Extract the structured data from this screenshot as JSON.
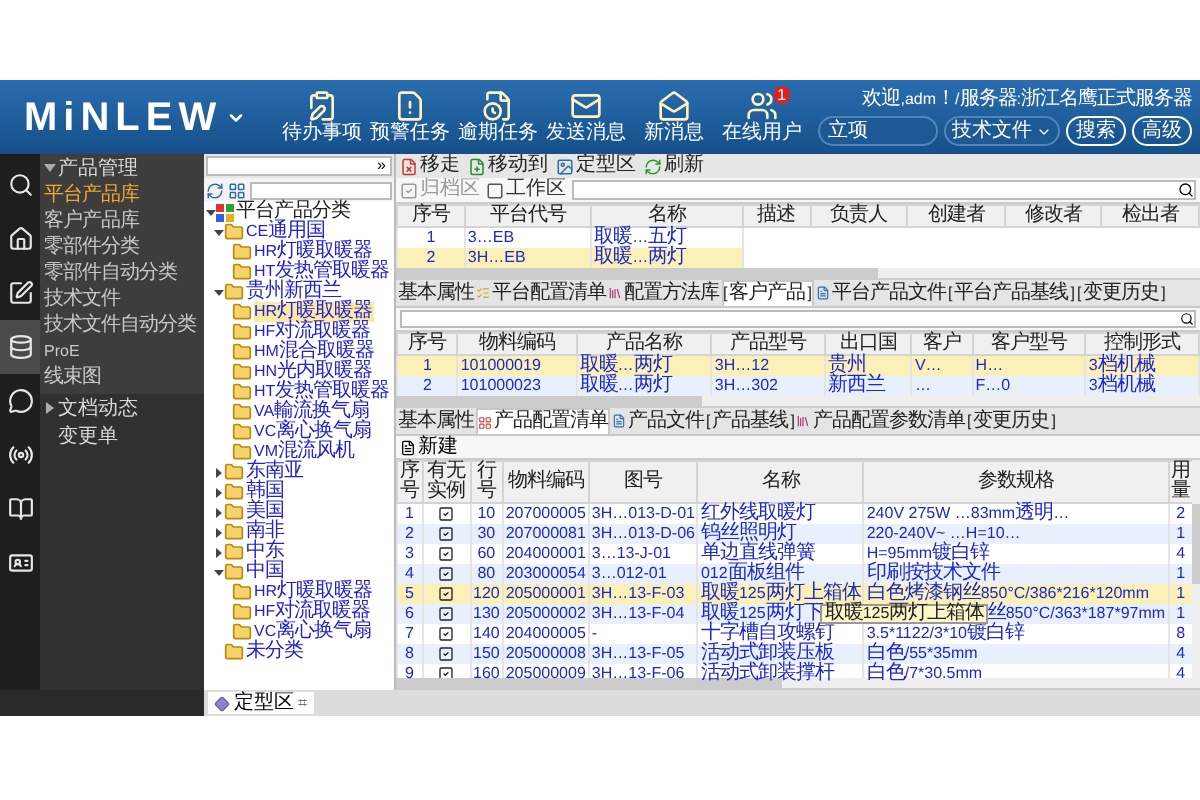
{
  "header": {
    "logo": "MiNLEW",
    "welcome": "欢迎,adm！/服务器:浙江名鹰正式服务器",
    "nav": [
      {
        "label": "待办事项"
      },
      {
        "label": "预警任务"
      },
      {
        "label": "逾期任务"
      },
      {
        "label": "发送消息"
      },
      {
        "label": "新消息"
      },
      {
        "label": "在线用户",
        "badge": "1"
      }
    ],
    "search": {
      "value": "立项"
    },
    "scope": {
      "value": "技术文件"
    },
    "buttons": [
      "搜索",
      "高级"
    ]
  },
  "sidebar": {
    "icons": [
      {
        "kind": "search",
        "selected": false
      },
      {
        "kind": "home",
        "selected": false
      },
      {
        "kind": "edit",
        "selected": false
      },
      {
        "kind": "database",
        "selected": true
      },
      {
        "kind": "chat",
        "selected": false
      },
      {
        "kind": "broadcast",
        "selected": false
      },
      {
        "kind": "book",
        "selected": false
      },
      {
        "kind": "card",
        "selected": false
      }
    ],
    "menu": [
      {
        "kind": "group",
        "label": "产品管理",
        "expanded": true,
        "children": [
          {
            "label": "平台产品库",
            "selected": true
          },
          {
            "label": "客户产品库",
            "selected": false
          },
          {
            "label": "零部件分类",
            "selected": false
          },
          {
            "label": "零部件自动分类",
            "selected": false
          },
          {
            "label": "技术文件",
            "selected": false
          },
          {
            "label": "技术文件自动分类",
            "selected": false
          },
          {
            "label": "ProE",
            "selected": false
          },
          {
            "label": "线束图",
            "selected": false
          }
        ]
      },
      {
        "kind": "group",
        "label": "文档动态",
        "expanded": false
      },
      {
        "kind": "item",
        "label": "变更单"
      }
    ]
  },
  "tree": {
    "dropdown": "»",
    "nodes": [
      {
        "kind": "root",
        "label": "平台产品分类",
        "expanded": true,
        "selected": false,
        "children": [
          {
            "label": "CE通用国",
            "expanded": true,
            "selected": false,
            "children": [
              {
                "label": "HR灯暖取暖器",
                "selected": false
              },
              {
                "label": "HT发热管取暖器",
                "selected": false
              }
            ]
          },
          {
            "label": "贵州新西兰",
            "expanded": true,
            "selected": false,
            "children": [
              {
                "label": "HR灯暖取暖器",
                "selected": true
              },
              {
                "label": "HF对流取暖器",
                "selected": false
              },
              {
                "label": "HM混合取暖器",
                "selected": false
              },
              {
                "label": "HN光内取暖器",
                "selected": false
              },
              {
                "label": "HT发热管取暖器",
                "selected": false
              },
              {
                "label": "VA輸流换气扇",
                "selected": false
              },
              {
                "label": "VC离心换气扇",
                "selected": false
              },
              {
                "label": "VM混流风机",
                "selected": false
              }
            ]
          },
          {
            "label": "东南亚",
            "expanded": false,
            "selected": false
          },
          {
            "label": "韩国",
            "expanded": false,
            "selected": false
          },
          {
            "label": "美国",
            "expanded": false,
            "selected": false
          },
          {
            "label": "南非",
            "expanded": false,
            "selected": false
          },
          {
            "label": "中东",
            "expanded": false,
            "selected": false
          },
          {
            "label": "中国",
            "expanded": true,
            "selected": false,
            "children": [
              {
                "label": "HR灯暖取暖器",
                "selected": false
              },
              {
                "label": "HF对流取暖器",
                "selected": false
              },
              {
                "label": "VC离心换气扇",
                "selected": false
              }
            ]
          },
          {
            "label": "未分类",
            "selected": false
          }
        ]
      }
    ]
  },
  "toolbar": [
    {
      "label": "移走"
    },
    {
      "label": "移动到"
    },
    {
      "label": "定型区"
    },
    {
      "label": "刷新"
    }
  ],
  "filter": {
    "checkboxes": [
      {
        "label": "归档区",
        "checked": true,
        "disabled": true
      },
      {
        "label": "工作区",
        "checked": false,
        "disabled": false
      }
    ]
  },
  "platform_table": {
    "columns": [
      "序号",
      "平台代号",
      "名称",
      "描述",
      "负责人",
      "创建者",
      "修改者",
      "检出者"
    ],
    "rows": [
      {
        "selected": false,
        "cells": [
          "1",
          "3…EB",
          "取暖…五灯"
        ]
      },
      {
        "selected": true,
        "cells": [
          "2",
          "3H…EB",
          "取暖…两灯"
        ]
      }
    ]
  },
  "upper_tabs": [
    {
      "label": "基本属性",
      "selected": false
    },
    {
      "label": "平台配置清单",
      "selected": false
    },
    {
      "label": "配置方法库",
      "selected": false
    },
    {
      "label": "[客户产品]",
      "selected": true
    },
    {
      "label": "平台产品文件",
      "selected": false
    },
    {
      "label": "[平台产品基线]",
      "selected": false
    },
    {
      "label": "[变更历史]",
      "selected": false
    }
  ],
  "customer_table": {
    "columns": [
      "序号",
      "物料编码",
      "产品名称",
      "产品型号",
      "出口国",
      "客户",
      "客户型号",
      "控制形式"
    ],
    "rows": [
      {
        "selected": true,
        "cells": [
          "1",
          "101000019",
          "取暖…两灯",
          "3H…12",
          "贵州",
          "V…",
          "H…",
          "3档机械"
        ]
      },
      {
        "selected": false,
        "cells": [
          "2",
          "101000023",
          "取暖…两灯",
          "3H…302",
          "新西兰",
          "…",
          "F…0",
          "3档机械"
        ]
      }
    ]
  },
  "lower_tabs": [
    {
      "label": "基本属性",
      "selected": false
    },
    {
      "label": "产品配置清单",
      "selected": true
    },
    {
      "label": "产品文件",
      "selected": false
    },
    {
      "label": "[产品基线]",
      "selected": false
    },
    {
      "label": "产品配置参数清单",
      "selected": false
    },
    {
      "label": "[变更历史]",
      "selected": false
    }
  ],
  "new_button": "新建",
  "bom_table": {
    "columns": [
      "序号",
      "有无实例",
      "行号",
      "物料编码",
      "图号",
      "名称",
      "参数规格",
      "用量"
    ],
    "rows": [
      {
        "selected": false,
        "has_instance": true,
        "cells": [
          "1",
          "",
          "10",
          "207000005",
          "3H…013-D-01",
          "红外线取暖灯",
          "240V 275W …83mm透明…",
          "2"
        ]
      },
      {
        "selected": false,
        "has_instance": true,
        "cells": [
          "2",
          "",
          "30",
          "207000081",
          "3H…013-D-06",
          "钨丝照明灯",
          "220-240V~ …H=10…",
          "1"
        ]
      },
      {
        "selected": false,
        "has_instance": true,
        "cells": [
          "3",
          "",
          "60",
          "204000001",
          "3…13-J-01",
          "单边直线弹簧",
          "H=95mm镀白锌",
          "4"
        ]
      },
      {
        "selected": false,
        "has_instance": true,
        "cells": [
          "4",
          "",
          "80",
          "203000054",
          "3…012-01",
          "012面板组件",
          "印刷按技术文件",
          "1"
        ]
      },
      {
        "selected": true,
        "has_instance": true,
        "cells": [
          "5",
          "",
          "120",
          "205000001",
          "3H…13-F-03",
          "取暖125两灯上箱体",
          "白色烤漆钢丝850°C/386*216*120mm",
          "1"
        ]
      },
      {
        "selected": false,
        "has_instance": true,
        "tooltip": "取暖125两灯上箱体",
        "cells": [
          "6",
          "",
          "130",
          "205000002",
          "3H…13-F-04",
          "取暖125两灯下",
          "丝850°C/363*187*97mm",
          "1"
        ]
      },
      {
        "selected": false,
        "has_instance": true,
        "cells": [
          "7",
          "",
          "140",
          "204000005",
          "-",
          "十字槽自攻螺钉",
          "3.5*1122/3*10镀白锌",
          "8"
        ]
      },
      {
        "selected": false,
        "has_instance": true,
        "cells": [
          "8",
          "",
          "150",
          "205000008",
          "3H…13-F-05",
          "活动式卸装压板",
          "白色/55*35mm",
          "4"
        ]
      },
      {
        "selected": false,
        "has_instance": true,
        "cells": [
          "9",
          "",
          "160",
          "205000009",
          "3H…13-F-06",
          "活动式卸装撑杆",
          "白色/7*30.5mm",
          "4"
        ]
      }
    ]
  },
  "bottom_tab": {
    "label": "定型区",
    "close": "⌗"
  }
}
